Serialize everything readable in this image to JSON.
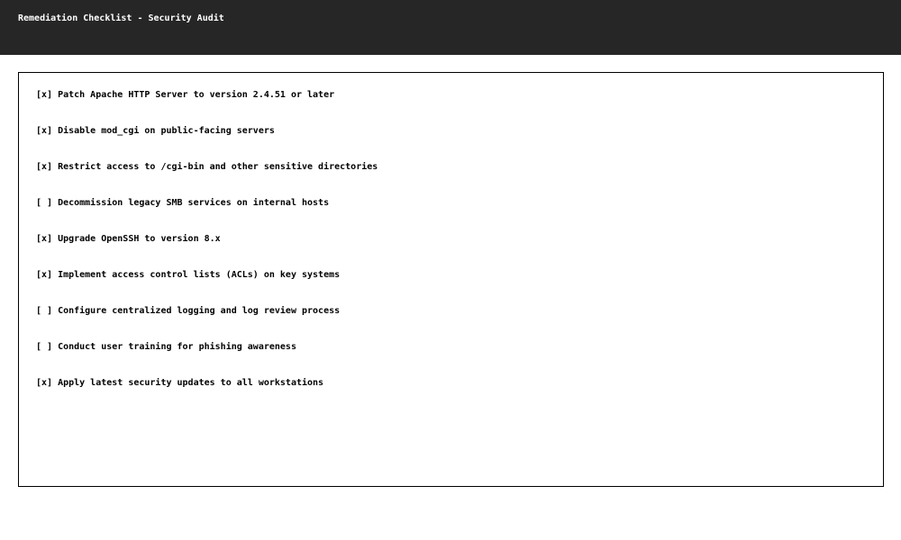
{
  "window": {
    "title": "Remediation Checklist - Security Audit"
  },
  "checklist": {
    "items": [
      {
        "mark": "[x]",
        "checked": true,
        "label": "Patch Apache HTTP Server to version 2.4.51 or later"
      },
      {
        "mark": "[x]",
        "checked": true,
        "label": "Disable mod_cgi on public-facing servers"
      },
      {
        "mark": "[x]",
        "checked": true,
        "label": "Restrict access to /cgi-bin and other sensitive directories"
      },
      {
        "mark": "[ ]",
        "checked": false,
        "label": "Decommission legacy SMB services on internal hosts"
      },
      {
        "mark": "[x]",
        "checked": true,
        "label": "Upgrade OpenSSH to version 8.x"
      },
      {
        "mark": "[x]",
        "checked": true,
        "label": "Implement access control lists (ACLs) on key systems"
      },
      {
        "mark": "[ ]",
        "checked": false,
        "label": "Configure centralized logging and log review process"
      },
      {
        "mark": "[ ]",
        "checked": false,
        "label": "Conduct user training for phishing awareness"
      },
      {
        "mark": "[x]",
        "checked": true,
        "label": "Apply latest security updates to all workstations"
      }
    ]
  },
  "colors": {
    "title_bar_bg": "#262626",
    "title_text": "#ffffff",
    "panel_border": "#000000",
    "text": "#000000"
  }
}
